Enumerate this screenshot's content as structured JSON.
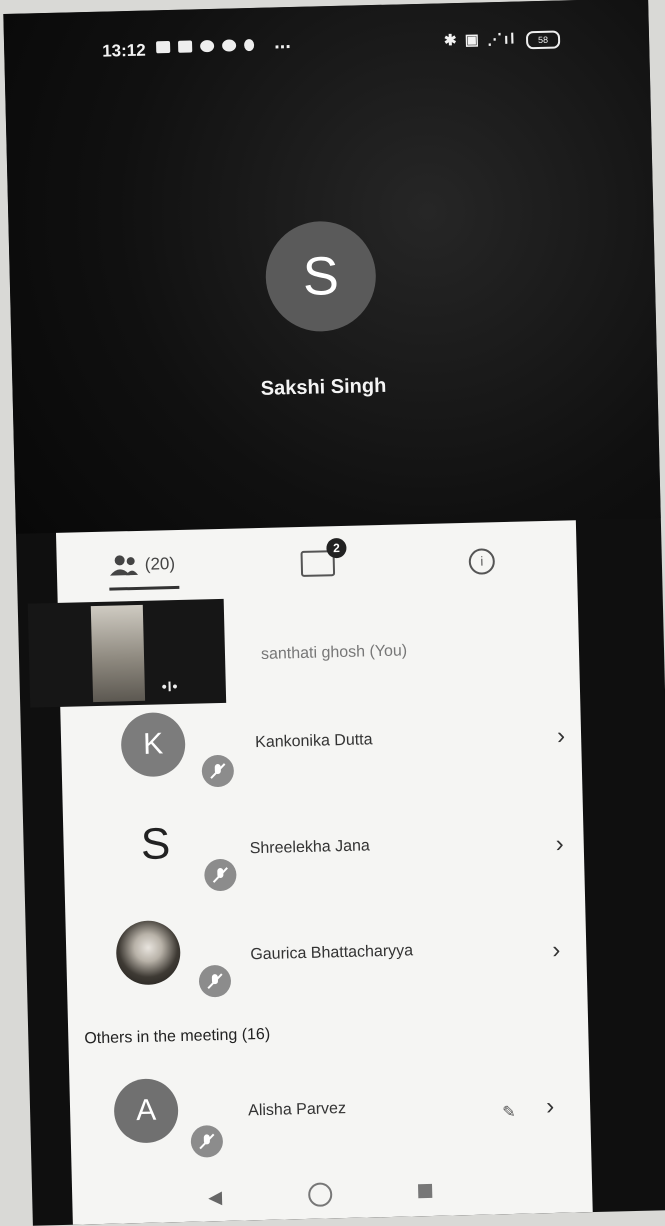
{
  "status_bar": {
    "time": "13:12",
    "more": "...",
    "right_icons": "✱ ▣ ⋰ıl",
    "battery": "58"
  },
  "speaker": {
    "initial": "S",
    "name": "Sakshi Singh"
  },
  "tabs": {
    "people_count": "(20)",
    "chat_badge": "2",
    "info_glyph": "i"
  },
  "self": {
    "name": "santhati ghosh (You)",
    "indicator": "•I•"
  },
  "participants": [
    {
      "initial": "K",
      "name": "Kankonika Dutta"
    },
    {
      "initial": "S",
      "name": "Shreelekha Jana"
    },
    {
      "initial": "",
      "name": "Gaurica Bhattacharyya"
    }
  ],
  "others_header": "Others in the meeting (16)",
  "others": [
    {
      "initial": "A",
      "name": "Alisha Parvez"
    }
  ],
  "chevron": "›",
  "colors": {
    "panel_bg": "#f5f5f3",
    "avatar_gray": "#7c7c7c",
    "dark_bg": "#0f0f0f"
  },
  "icons": [
    "people-icon",
    "chat-icon",
    "info-icon",
    "mic-off-icon",
    "chevron-right-icon",
    "back-icon",
    "home-icon",
    "recents-icon"
  ]
}
